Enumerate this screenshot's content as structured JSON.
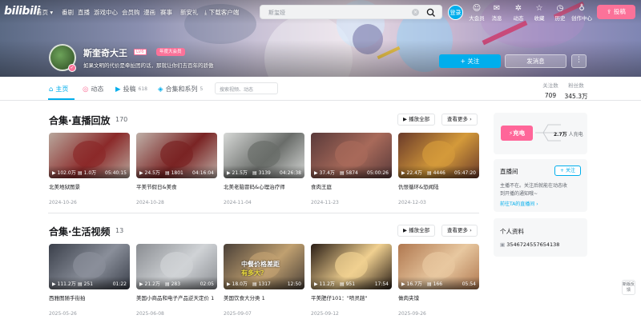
{
  "nav": {
    "logo": "bilibili",
    "items": [
      "首页",
      "番剧",
      "直播",
      "游戏中心",
      "会员购",
      "漫画",
      "赛事",
      "新安礼",
      "下载客户端"
    ],
    "search_placeholder": "斯玺娅",
    "avatar": "登录",
    "icons": [
      {
        "label": "大会员",
        "icon": "vip-icon"
      },
      {
        "label": "消息",
        "icon": "message-icon"
      },
      {
        "label": "动态",
        "icon": "dynamic-icon"
      },
      {
        "label": "收藏",
        "icon": "star-icon"
      },
      {
        "label": "历史",
        "icon": "history-icon"
      },
      {
        "label": "创作中心",
        "icon": "bulb-icon"
      }
    ],
    "upload": "投稿"
  },
  "profile": {
    "name": "斯奎奇大王",
    "level": "LV6",
    "vip": "年度大会员",
    "sign": "如果文明的代价是牵扯团的话，那就让你们去百年的骄傲",
    "follow": "+ 关注",
    "message": "发消息",
    "more": "⋮"
  },
  "tabs": [
    {
      "label": "主页",
      "icon": "⌂",
      "count": "",
      "active": true
    },
    {
      "label": "动态",
      "icon": "◎",
      "count": "",
      "active": false
    },
    {
      "label": "投稿",
      "icon": "▶",
      "count": "618",
      "active": false
    },
    {
      "label": "合集和系列",
      "icon": "◈",
      "count": "5",
      "active": false
    }
  ],
  "tab_search_placeholder": "搜索视频、动态",
  "stats": [
    {
      "label": "关注数",
      "value": "709"
    },
    {
      "label": "粉丝数",
      "value": "345.3万"
    }
  ],
  "sections": [
    {
      "title": "合集·直播回放",
      "count": "170",
      "play_all": "▶ 播放全部",
      "see_more": "查看更多 ›",
      "videos": [
        {
          "views": "102.0万",
          "danmaku": "1.0万",
          "duration": "05:40:15",
          "title": "北美地狱图景",
          "date": "2024-10-26",
          "bg": "#b8a79c",
          "fg": "#8b2a2a"
        },
        {
          "views": "24.5万",
          "danmaku": "1801",
          "duration": "04:16:04",
          "title": "平美节假日&美食",
          "date": "2024-10-28",
          "bg": "#bfb0a8",
          "fg": "#7a2424"
        },
        {
          "views": "21.5万",
          "danmaku": "3139",
          "duration": "04:26:38",
          "title": "北美老脑冒码&心理治疗师",
          "date": "2024-11-04",
          "bg": "#d6d8d6",
          "fg": "#6a6d6a"
        },
        {
          "views": "37.4万",
          "danmaku": "5874",
          "duration": "05:00:26",
          "title": "食肉王庭",
          "date": "2024-11-23",
          "bg": "#5a3a3a",
          "fg": "#a86a5a"
        },
        {
          "views": "22.4万",
          "danmaku": "4446",
          "duration": "05:47:20",
          "title": "仇恨循环&恐闻陆",
          "date": "2024-12-03",
          "bg": "#6a3a2a",
          "fg": "#d49a3a"
        }
      ]
    },
    {
      "title": "合集·生活视频",
      "count": "13",
      "play_all": "▶ 播放全部",
      "see_more": "查看更多 ›",
      "videos": [
        {
          "views": "111.2万",
          "danmaku": "251",
          "duration": "01:22",
          "title": "西雅图随手街拍",
          "date": "2025-05-26",
          "bg": "#3a3f4a",
          "fg": "#8a8f9a"
        },
        {
          "views": "21.2万",
          "danmaku": "283",
          "duration": "02:05",
          "title": "美国小商品和电子产品逆天定价 1",
          "date": "2025-06-08",
          "bg": "#8a8d92",
          "fg": "#d0d3d6"
        },
        {
          "views": "18.0万",
          "danmaku": "1317",
          "duration": "12:50",
          "title": "美国饮食大分类 1",
          "date": "2025-09-07",
          "bg": "#4a4038",
          "fg": "#c0a070",
          "overlay1": "中餐价格差距",
          "overlay2": "有多大？"
        },
        {
          "views": "11.2万",
          "danmaku": "951",
          "duration": "17:54",
          "title": "平美肥仔101：\"喷灵趟\"",
          "date": "2025-09-12",
          "bg": "#2a1e16",
          "fg": "#f0d090"
        },
        {
          "views": "16.7万",
          "danmaku": "166",
          "duration": "05:54",
          "title": "做肉夹馍",
          "date": "2025-09-26",
          "bg": "#b07850",
          "fg": "#e8c8a0"
        }
      ]
    }
  ],
  "right": {
    "charge_btn": "充电",
    "charge_count": "2.7万",
    "charge_suffix": "人充电",
    "live_title": "直播间",
    "live_follow": "+ 关注",
    "live_desc1": "主播不在。关注后就能在动态收",
    "live_desc2": "到开播的通知哦~",
    "live_link": "前往TA的直播间 ›",
    "info_title": "个人资料",
    "uid": "3546724557654138"
  },
  "side_button": "新版反馈",
  "colors": {
    "accent": "#00aeec",
    "pink": "#fb7299"
  }
}
